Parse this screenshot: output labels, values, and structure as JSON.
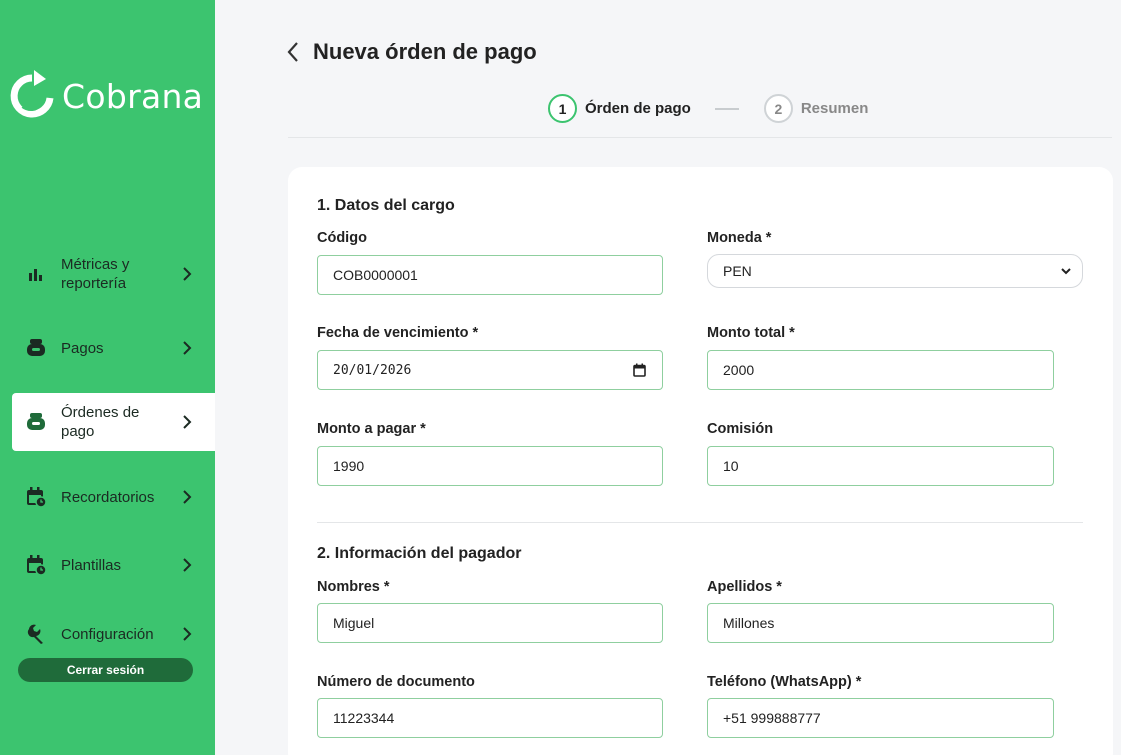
{
  "brand": {
    "name": "Cobrana"
  },
  "colors": {
    "accent": "#3cc46f",
    "logout_bg": "#1f6b3a",
    "input_border": "#8fcf9f"
  },
  "sidebar": {
    "items": [
      {
        "label": "Métricas y reportería",
        "icon": "bar-chart-icon"
      },
      {
        "label": "Pagos",
        "icon": "wallet-icon"
      },
      {
        "label": "Órdenes de pago",
        "icon": "wallet-icon",
        "active": true
      },
      {
        "label": "Recordatorios",
        "icon": "calendar-clock-icon"
      },
      {
        "label": "Plantillas",
        "icon": "calendar-clock-icon"
      },
      {
        "label": "Configuración",
        "icon": "wrench-icon"
      }
    ],
    "logout_label": "Cerrar sesión"
  },
  "header": {
    "title": "Nueva órden de pago",
    "steps": [
      {
        "number": "1",
        "label": "Órden de pago",
        "active": true
      },
      {
        "number": "2",
        "label": "Resumen",
        "active": false
      }
    ]
  },
  "form": {
    "section1": {
      "title": "1. Datos del cargo",
      "codigo": {
        "label": "Código",
        "value": "COB0000001"
      },
      "moneda": {
        "label": "Moneda *",
        "value": "PEN"
      },
      "fecha": {
        "label": "Fecha de vencimiento *",
        "value": "20/01/2026"
      },
      "monto_total": {
        "label": "Monto total *",
        "value": "2000"
      },
      "monto_pagar": {
        "label": "Monto a pagar *",
        "value": "1990"
      },
      "comision": {
        "label": "Comisión",
        "value": "10"
      }
    },
    "section2": {
      "title": "2. Información del pagador",
      "nombres": {
        "label": "Nombres *",
        "value": "Miguel"
      },
      "apellidos": {
        "label": "Apellidos *",
        "value": "Millones"
      },
      "documento": {
        "label": "Número de documento",
        "value": "11223344"
      },
      "telefono": {
        "label": "Teléfono (WhatsApp) *",
        "value": "+51 999888777"
      }
    }
  }
}
